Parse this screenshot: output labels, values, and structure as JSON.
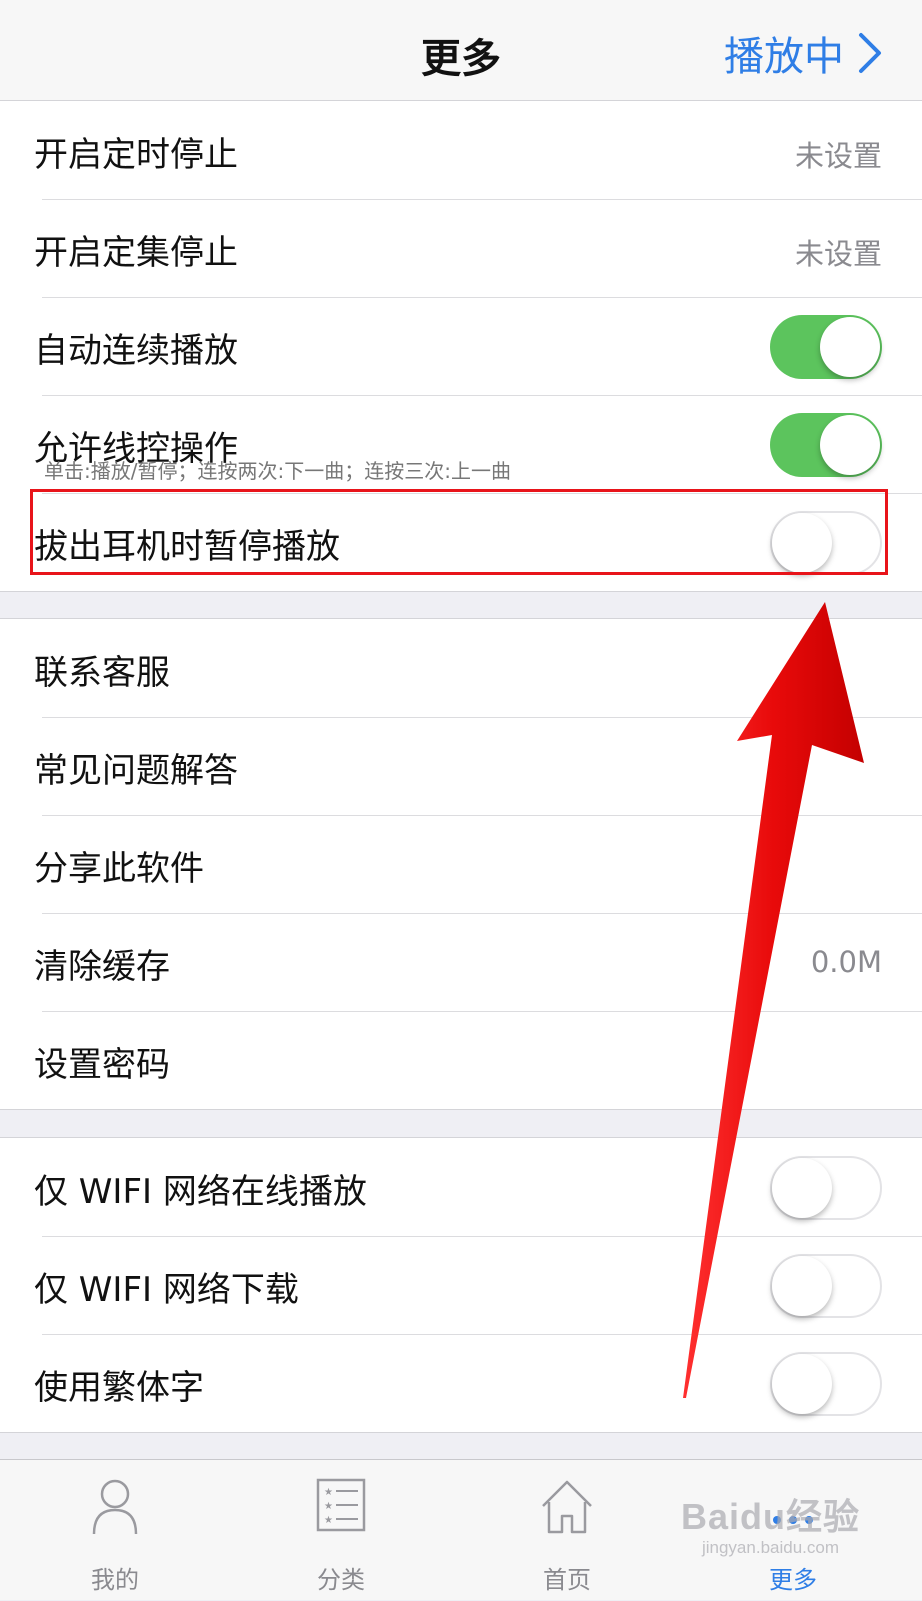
{
  "nav": {
    "title": "更多",
    "right_label": "播放中"
  },
  "group1": [
    {
      "label": "开启定时停止",
      "value": "未设置"
    },
    {
      "label": "开启定集停止",
      "value": "未设置"
    },
    {
      "label": "自动连续播放",
      "toggle": "on"
    },
    {
      "label": "允许线控操作",
      "sub": "单击:播放/暂停；连按两次:下一曲；连按三次:上一曲",
      "toggle": "on"
    },
    {
      "label": "拔出耳机时暂停播放",
      "toggle": "off"
    }
  ],
  "group2": [
    {
      "label": "联系客服"
    },
    {
      "label": "常见问题解答"
    },
    {
      "label": "分享此软件"
    },
    {
      "label": "清除缓存",
      "value": "0.0M"
    },
    {
      "label": "设置密码"
    }
  ],
  "group3": [
    {
      "label": "仅 WIFI 网络在线播放",
      "toggle": "off"
    },
    {
      "label": "仅 WIFI 网络下载",
      "toggle": "off"
    },
    {
      "label": "使用繁体字",
      "toggle": "off"
    }
  ],
  "tabs": [
    {
      "label": "我的",
      "icon": "person-icon"
    },
    {
      "label": "分类",
      "icon": "list-icon"
    },
    {
      "label": "首页",
      "icon": "home-icon"
    },
    {
      "label": "更多",
      "icon": "more-icon",
      "active": true
    }
  ],
  "watermark": {
    "main": "Baidu经验",
    "sub": "jingyan.baidu.com"
  },
  "colors": {
    "accent": "#2f7ee6",
    "toggle_on": "#5cc45d",
    "annotation": "#e8141a"
  }
}
